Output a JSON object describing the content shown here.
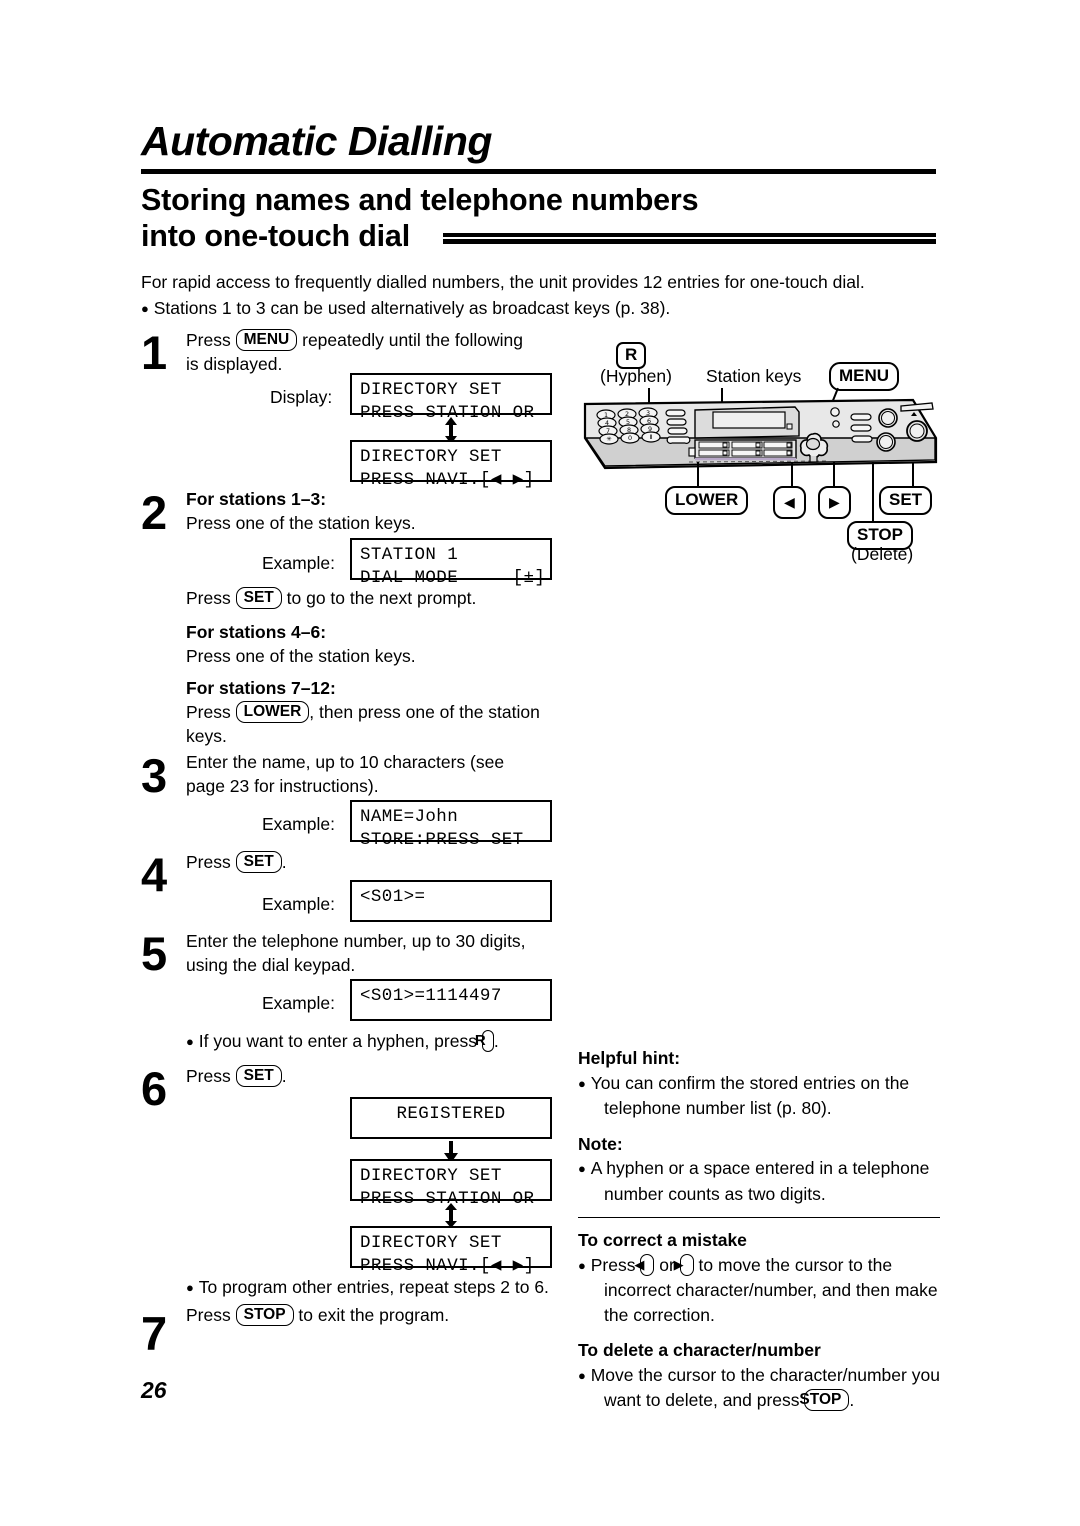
{
  "chapter": {
    "title": "Automatic Dialling"
  },
  "section": {
    "line1": "Storing names and telephone numbers",
    "line2": "into one-touch dial"
  },
  "intro": {
    "paragraph": "For rapid access to frequently dialled numbers, the unit provides 12 entries for one-touch dial.",
    "bullet": "Stations 1 to 3 can be used alternatively as broadcast keys (p. 38)."
  },
  "labels": {
    "display": "Display:",
    "example": "Example:"
  },
  "steps": {
    "s1": {
      "num": "1",
      "text_a": "Press",
      "key": "MENU",
      "text_b": "repeatedly until the following",
      "text_c": "is displayed."
    },
    "s2": {
      "num": "2",
      "head1": "For stations 1–3:",
      "line1": "Press one of the station keys.",
      "press_a": "Press",
      "press_key": "SET",
      "press_b": "to go to the next prompt.",
      "head2": "For stations 4–6:",
      "line2": "Press one of the station keys.",
      "head3": "For stations 7–12:",
      "line3_a": "Press",
      "line3_key": "LOWER",
      "line3_b": ", then press one of the station",
      "line3_c": "keys."
    },
    "s3": {
      "num": "3",
      "text_a": "Enter the name, up to 10 characters (see",
      "text_b": "page 23 for instructions)."
    },
    "s4": {
      "num": "4",
      "text_a": "Press",
      "key": "SET",
      "text_b": "."
    },
    "s5": {
      "num": "5",
      "text_a": "Enter the telephone number, up to 30 digits,",
      "text_b": "using the dial keypad.",
      "bullet_a": "If you want to enter a hyphen, press",
      "bullet_key": "R",
      "bullet_b": "."
    },
    "s6": {
      "num": "6",
      "text_a": "Press",
      "key": "SET",
      "text_b": ".",
      "bullet": "To program other entries, repeat steps 2 to 6."
    },
    "s7": {
      "num": "7",
      "text_a": "Press",
      "key": "STOP",
      "text_b": "to exit the program."
    }
  },
  "lcd": {
    "d1": {
      "line1": "DIRECTORY SET",
      "line2": "PRESS STATION OR"
    },
    "d2": {
      "line1": "DIRECTORY SET",
      "line2": "PRESS NAVI.[◀ ▶]"
    },
    "d3": {
      "line1": "STATION 1",
      "line2": "DIAL MODE     [±]"
    },
    "d4": {
      "line1": "NAME=John",
      "line2": "STORE:PRESS SET"
    },
    "d5": {
      "line1": "<S01>=",
      "line2": ""
    },
    "d6": {
      "line1": "<S01>=1114497",
      "line2": ""
    },
    "d7": {
      "line1": "REGISTERED",
      "line2": ""
    },
    "d8": {
      "line1": "DIRECTORY SET",
      "line2": "PRESS STATION OR"
    },
    "d9": {
      "line1": "DIRECTORY SET",
      "line2": "PRESS NAVI.[◀ ▶]"
    }
  },
  "device": {
    "r_key": "R",
    "hyphen_label": "(Hyphen)",
    "station_keys_label": "Station keys",
    "menu_key": "MENU",
    "lower_key": "LOWER",
    "left_key": "◀",
    "right_key": "▶",
    "set_key": "SET",
    "stop_key": "STOP",
    "delete_label": "(Delete)",
    "keypad": [
      "1",
      "2",
      "3",
      "4",
      "5",
      "6",
      "7",
      "8",
      "9",
      "∗",
      "0",
      "Ⅱ"
    ]
  },
  "help": {
    "hint_head": "Helpful hint:",
    "hint_line1": "You can confirm the stored entries on the",
    "hint_line2": "telephone number list (p. 80).",
    "note_head": "Note:",
    "note_line1": "A hyphen or a space entered in a telephone",
    "note_line2": "number counts as two digits.",
    "correct_head": "To correct a mistake",
    "correct_a": "Press",
    "correct_key1": "◀",
    "correct_or": "or",
    "correct_key2": "▶",
    "correct_b": "to move the cursor to the",
    "correct_c": "incorrect character/number, and then make",
    "correct_d": "the correction.",
    "delete_head": "To delete a character/number",
    "delete_a": "Move the cursor to the character/number you",
    "delete_b": "want to delete, and press",
    "delete_key": "STOP",
    "delete_c": "."
  },
  "footer": {
    "page_number": "26"
  }
}
